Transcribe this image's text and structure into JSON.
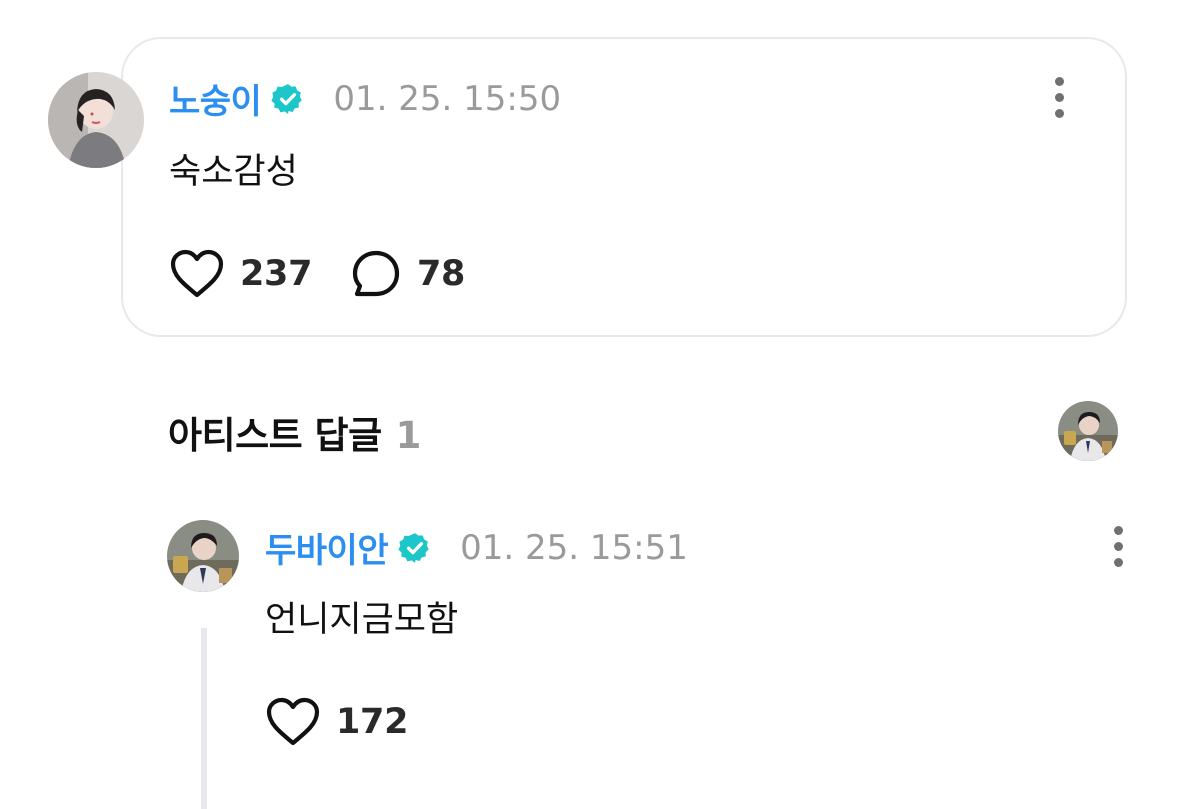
{
  "post": {
    "author": "노숭이",
    "timestamp": "01. 25. 15:50",
    "text": "숙소감성",
    "likes": "237",
    "comments": "78"
  },
  "artist_replies": {
    "title": "아티스트 답글",
    "count": "1"
  },
  "reply": {
    "author": "두바이안",
    "timestamp": "01. 25. 15:51",
    "text": "언니지금모함",
    "likes": "172"
  },
  "colors": {
    "author_name": "#2b8ef0",
    "verified_badge": "#1cc6c9",
    "timestamp": "#9a9a9a",
    "card_border": "#e6e8ee",
    "section_count": "#9a9a9a"
  },
  "icons": {
    "verified": "verified-badge-icon",
    "more": "more-vertical-icon",
    "like": "heart-outline-icon",
    "comment": "speech-bubble-icon"
  }
}
